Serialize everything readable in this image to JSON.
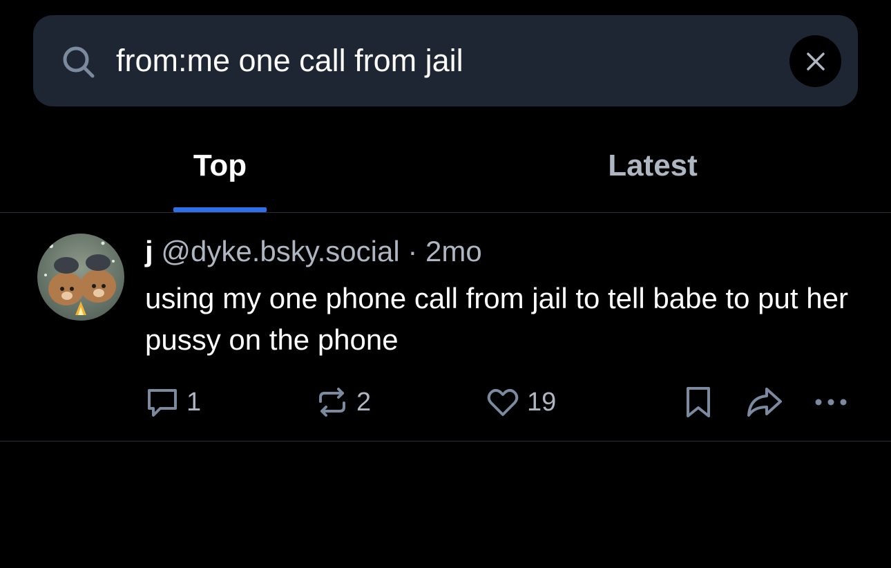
{
  "search": {
    "query": "from:me one call from jail"
  },
  "tabs": [
    {
      "label": "Top",
      "active": true
    },
    {
      "label": "Latest",
      "active": false
    }
  ],
  "post": {
    "author_name": "j",
    "author_handle": "@dyke.bsky.social",
    "separator": "·",
    "time": "2mo",
    "text": "using my one phone call from jail to tell babe to put her pussy on the phone",
    "reply_count": "1",
    "repost_count": "2",
    "like_count": "19"
  },
  "colors": {
    "background": "#000000",
    "search_bg": "#1e2533",
    "accent": "#2f6fe8",
    "muted_text": "#aeb6c2",
    "icon": "#7b8a9e"
  }
}
